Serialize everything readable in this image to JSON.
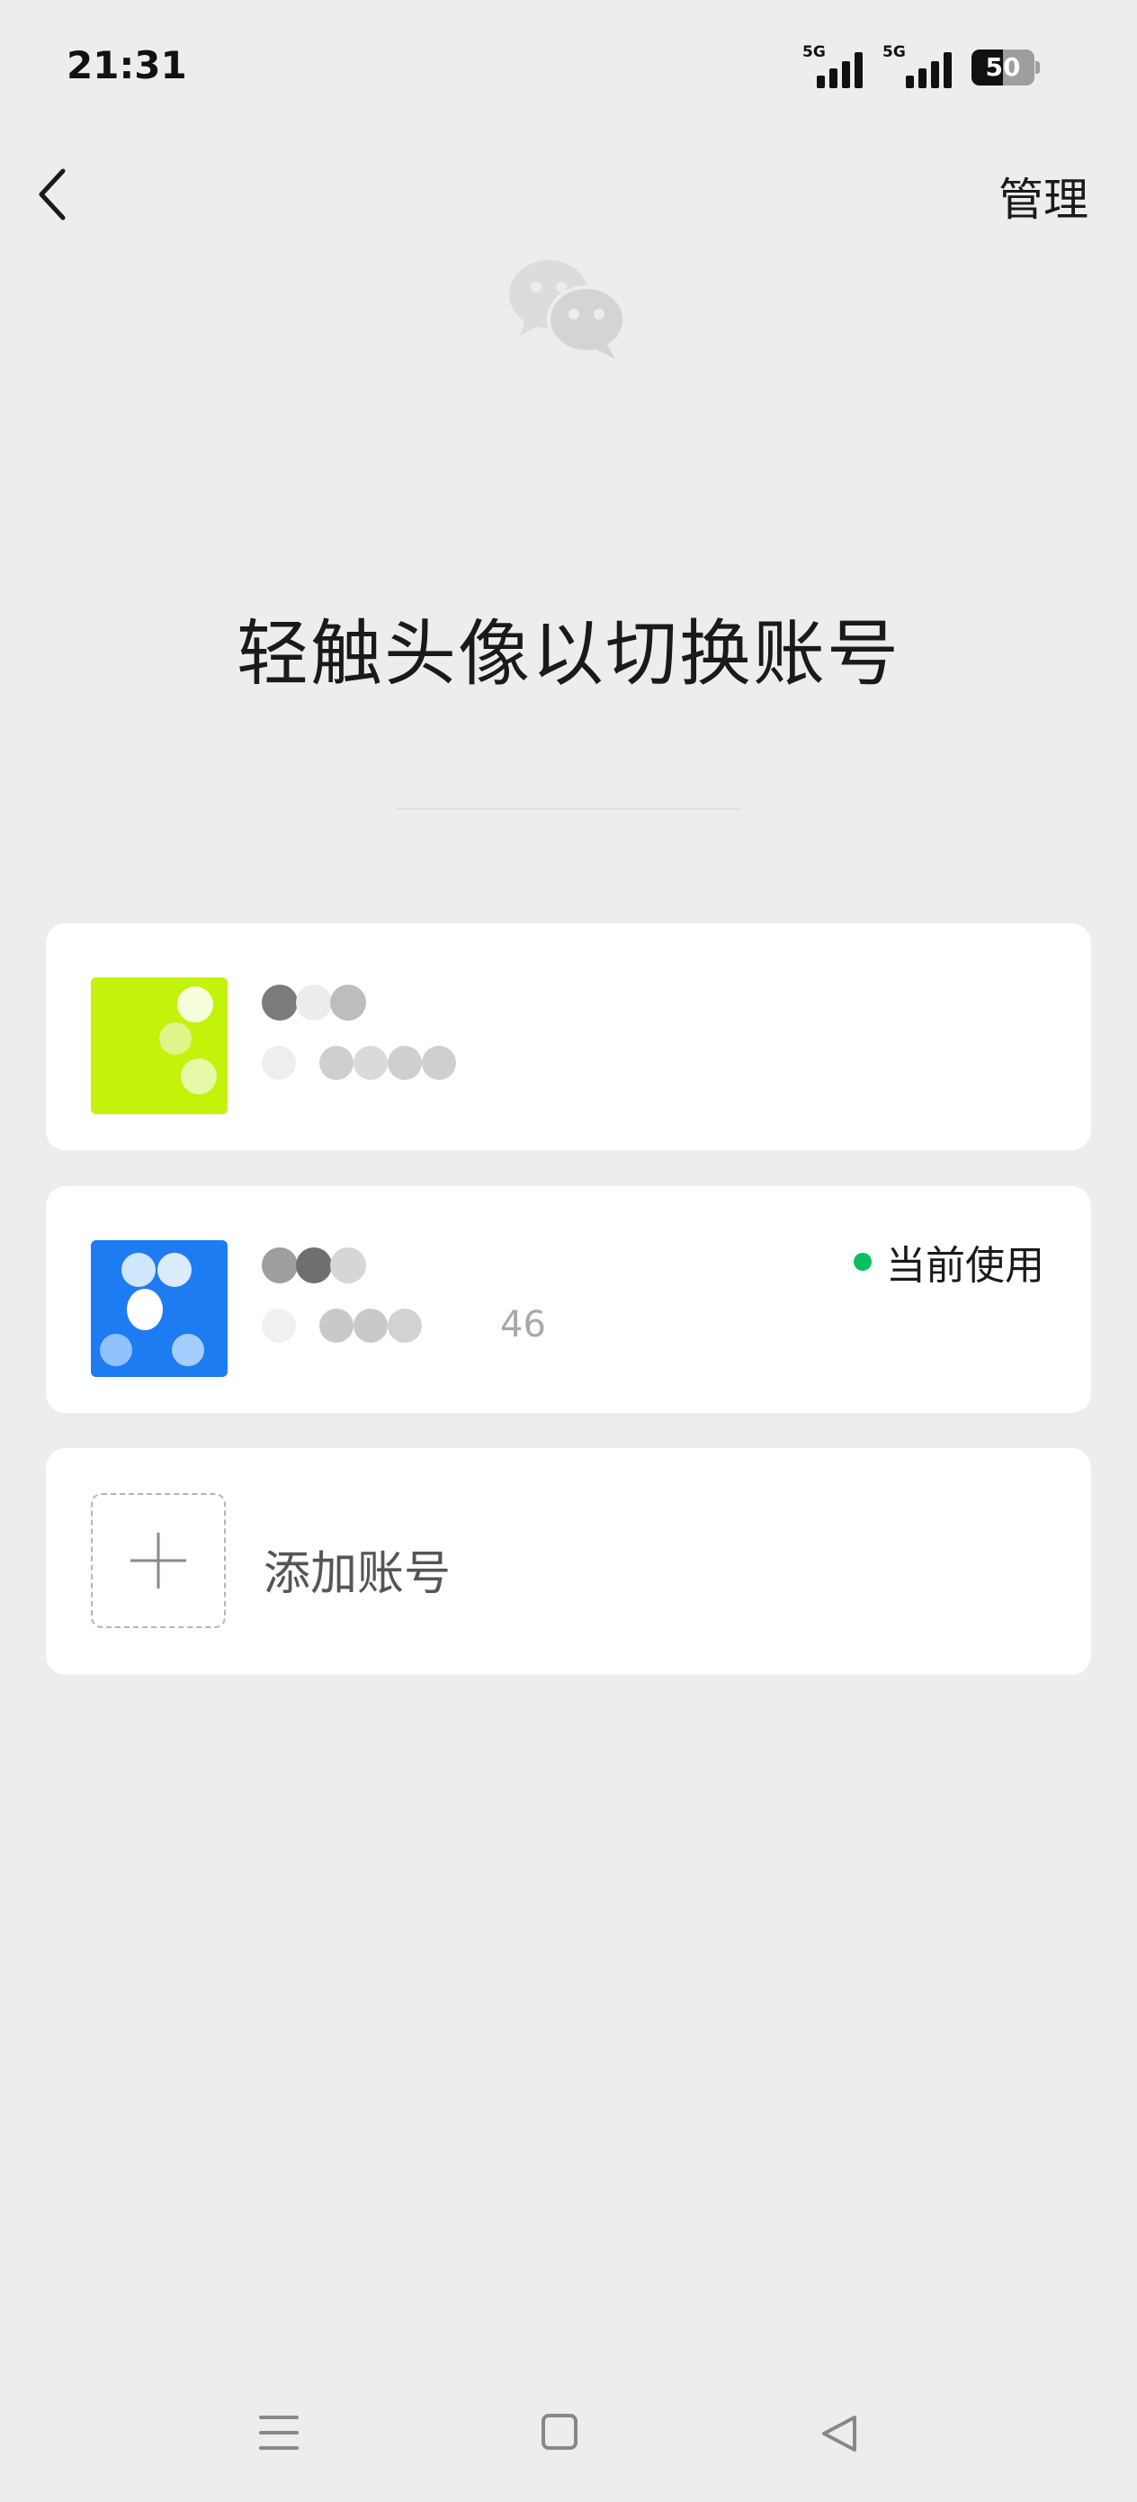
{
  "status_bar": {
    "time": "21:31",
    "network_1": "5G",
    "network_2": "5G",
    "battery_level": "50",
    "battery_fraction": 0.5
  },
  "nav": {
    "manage_label": "管理"
  },
  "hint_text": "轻触头像以切换账号",
  "accounts": [
    {
      "avatar_color": "#c3f20b",
      "current": false
    },
    {
      "avatar_color": "#1e7cf2",
      "current": true,
      "sub_suffix": "46",
      "current_label": "当前使用"
    }
  ],
  "add_account_label": "添加账号",
  "icons": [
    "back-arrow-icon",
    "wechat-logo-icon",
    "plus-icon",
    "menu-icon",
    "home-icon",
    "back-triangle-icon",
    "signal-icon",
    "battery-icon"
  ],
  "colors": {
    "background": "#ededed",
    "card": "#ffffff",
    "active_dot": "#07c160"
  }
}
